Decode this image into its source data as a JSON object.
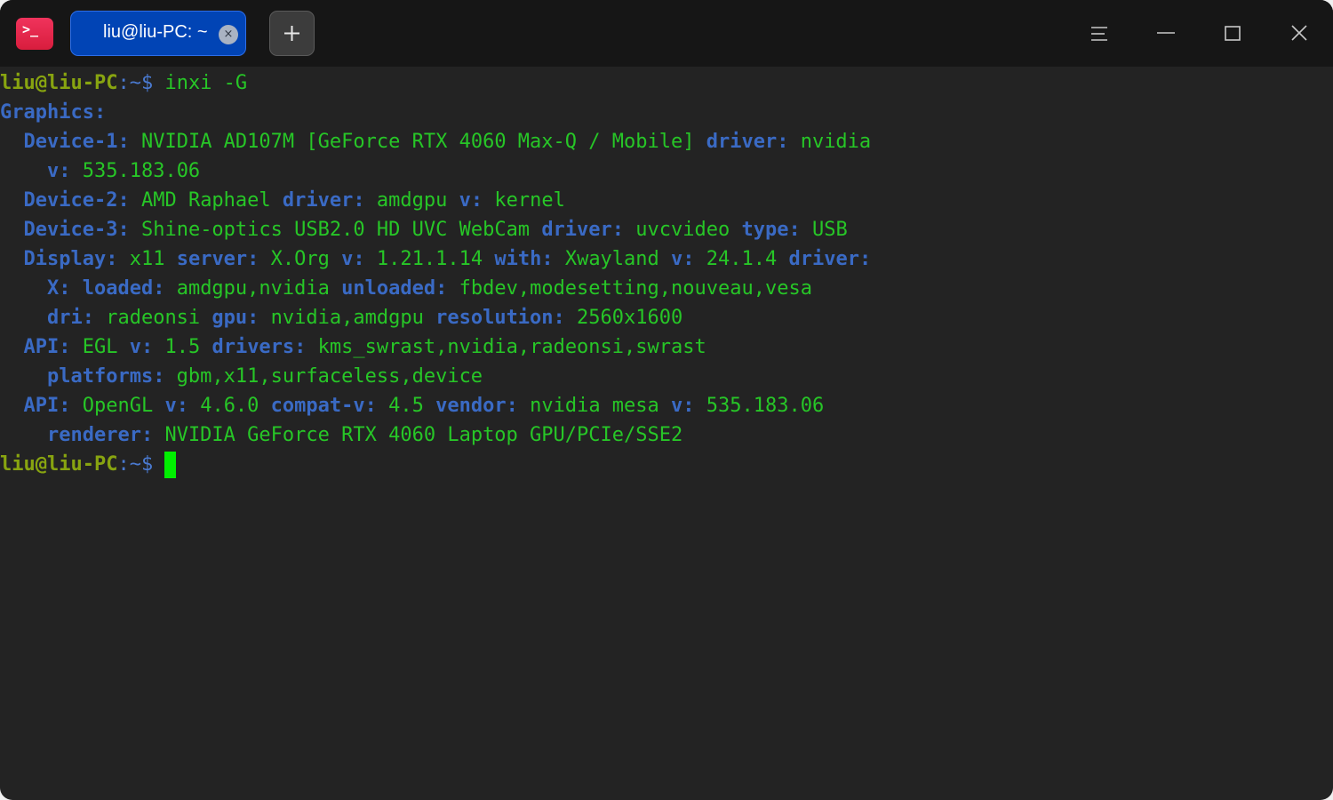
{
  "app": {
    "icon_glyph": ">_",
    "tab_title": "liu@liu-PC: ~",
    "tab_close_glyph": "×",
    "colors": {
      "accent": "#0144b5",
      "titlebar": "#161616",
      "background": "#232323",
      "key": "#3a6ac4",
      "value": "#27c627",
      "prompt_user": "#88a410",
      "cursor": "#00ef00"
    }
  },
  "icons": [
    "terminal-app-icon",
    "close-icon",
    "plus-icon",
    "menu-icon",
    "minimize-icon",
    "maximize-icon",
    "window-close-icon"
  ],
  "prompt": {
    "user": "liu@liu-PC",
    "path": ":~",
    "symbol": "$ "
  },
  "command": "inxi -G",
  "output": {
    "heading": "Graphics:",
    "lines": [
      {
        "indent": "  ",
        "segments": [
          {
            "k": "Device-1:"
          },
          {
            "v": " NVIDIA AD107M [GeForce RTX 4060 Max-Q / Mobile] "
          },
          {
            "k": "driver:"
          },
          {
            "v": " nvidia"
          }
        ]
      },
      {
        "indent": "    ",
        "segments": [
          {
            "k": "v:"
          },
          {
            "v": " 535.183.06"
          }
        ]
      },
      {
        "indent": "  ",
        "segments": [
          {
            "k": "Device-2:"
          },
          {
            "v": " AMD Raphael "
          },
          {
            "k": "driver:"
          },
          {
            "v": " amdgpu "
          },
          {
            "k": "v:"
          },
          {
            "v": " kernel"
          }
        ]
      },
      {
        "indent": "  ",
        "segments": [
          {
            "k": "Device-3:"
          },
          {
            "v": " Shine-optics USB2.0 HD UVC WebCam "
          },
          {
            "k": "driver:"
          },
          {
            "v": " uvcvideo "
          },
          {
            "k": "type:"
          },
          {
            "v": " USB"
          }
        ]
      },
      {
        "indent": "  ",
        "segments": [
          {
            "k": "Display:"
          },
          {
            "v": " x11 "
          },
          {
            "k": "server:"
          },
          {
            "v": " X.Org "
          },
          {
            "k": "v:"
          },
          {
            "v": " 1.21.1.14 "
          },
          {
            "k": "with:"
          },
          {
            "v": " Xwayland "
          },
          {
            "k": "v:"
          },
          {
            "v": " 24.1.4 "
          },
          {
            "k": "driver:"
          }
        ]
      },
      {
        "indent": "    ",
        "segments": [
          {
            "k": "X:"
          },
          {
            "v": " "
          },
          {
            "k": "loaded:"
          },
          {
            "v": " amdgpu,nvidia "
          },
          {
            "k": "unloaded:"
          },
          {
            "v": " fbdev,modesetting,nouveau,vesa"
          }
        ]
      },
      {
        "indent": "    ",
        "segments": [
          {
            "k": "dri:"
          },
          {
            "v": " radeonsi "
          },
          {
            "k": "gpu:"
          },
          {
            "v": " nvidia,amdgpu "
          },
          {
            "k": "resolution:"
          },
          {
            "v": " 2560x1600"
          }
        ]
      },
      {
        "indent": "  ",
        "segments": [
          {
            "k": "API:"
          },
          {
            "v": " EGL "
          },
          {
            "k": "v:"
          },
          {
            "v": " 1.5 "
          },
          {
            "k": "drivers:"
          },
          {
            "v": " kms_swrast,nvidia,radeonsi,swrast"
          }
        ]
      },
      {
        "indent": "    ",
        "segments": [
          {
            "k": "platforms:"
          },
          {
            "v": " gbm,x11,surfaceless,device"
          }
        ]
      },
      {
        "indent": "  ",
        "segments": [
          {
            "k": "API:"
          },
          {
            "v": " OpenGL "
          },
          {
            "k": "v:"
          },
          {
            "v": " 4.6.0 "
          },
          {
            "k": "compat-v:"
          },
          {
            "v": " 4.5 "
          },
          {
            "k": "vendor:"
          },
          {
            "v": " nvidia mesa "
          },
          {
            "k": "v:"
          },
          {
            "v": " 535.183.06"
          }
        ]
      },
      {
        "indent": "    ",
        "segments": [
          {
            "k": "renderer:"
          },
          {
            "v": " NVIDIA GeForce RTX 4060 Laptop GPU/PCIe/SSE2"
          }
        ]
      }
    ]
  }
}
